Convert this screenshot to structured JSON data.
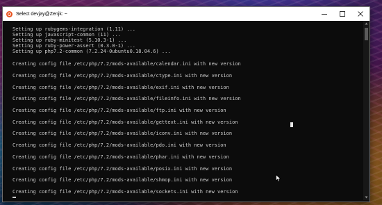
{
  "window": {
    "title": "Select devjay@Zenjk: ~",
    "controls": {
      "minimize": "minimize",
      "maximize": "maximize",
      "close": "close"
    }
  },
  "terminal": {
    "setup_lines": [
      "Setting up rubygems-integration (1.11) ...",
      "Setting up javascript-common (11) ...",
      "Setting up ruby-minitest (5.10.3-1) ...",
      "Setting up ruby-power-assert (0.3.0-1) ...",
      "Setting up php7.2-common (7.2.24-0ubuntu0.18.04.6) ..."
    ],
    "config_lines": [
      "Creating config file /etc/php/7.2/mods-available/calendar.ini with new version",
      "Creating config file /etc/php/7.2/mods-available/ctype.ini with new version",
      "Creating config file /etc/php/7.2/mods-available/exif.ini with new version",
      "Creating config file /etc/php/7.2/mods-available/fileinfo.ini with new version",
      "Creating config file /etc/php/7.2/mods-available/ftp.ini with new version",
      "Creating config file /etc/php/7.2/mods-available/gettext.ini with new version",
      "Creating config file /etc/php/7.2/mods-available/iconv.ini with new version",
      "Creating config file /etc/php/7.2/mods-available/pdo.ini with new version",
      "Creating config file /etc/php/7.2/mods-available/phar.ini with new version",
      "Creating config file /etc/php/7.2/mods-available/posix.ini with new version",
      "Creating config file /etc/php/7.2/mods-available/shmop.ini with new version",
      "Creating config file /etc/php/7.2/mods-available/sockets.ini with new version"
    ]
  },
  "icons": {
    "app": "ubuntu-icon",
    "pointer": "mouse-pointer-icon"
  },
  "colors": {
    "terminal_bg": "#0c0c0c",
    "terminal_text": "#cccccc",
    "titlebar_bg": "#ffffff",
    "app_icon": "#e95420"
  }
}
